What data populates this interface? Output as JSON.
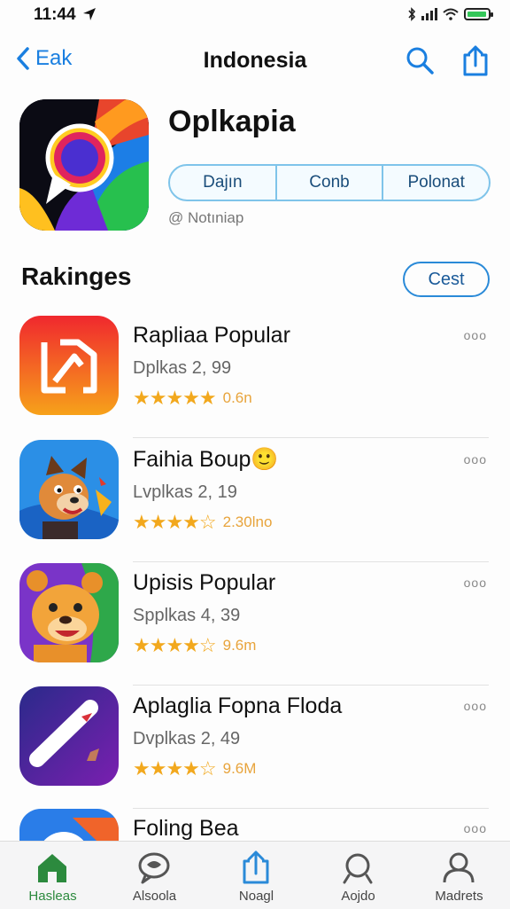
{
  "status": {
    "time": "11:44"
  },
  "nav": {
    "back_label": "Eak",
    "title": "Indonesia"
  },
  "app": {
    "title": "Oplkapia",
    "segments": [
      "Dajın",
      "Conb",
      "Polonat"
    ],
    "subtitle": "@ Notıniap"
  },
  "rankings": {
    "title": "Rakinges",
    "action_label": "Cest",
    "items": [
      {
        "name": "Rapliaa Popular",
        "subtitle": "Dplkas 2, 99",
        "stars": "★★★★★",
        "count": "0.6n",
        "more": "ooo"
      },
      {
        "name": "Faihia Boup🙂",
        "subtitle": "Lvplkas 2, 19",
        "stars": "★★★★☆",
        "count": "2.30lno",
        "more": "ooo"
      },
      {
        "name": "Upisis Popular",
        "subtitle": "Spplkas 4, 39",
        "stars": "★★★★☆",
        "count": "9.6m",
        "more": "ooo"
      },
      {
        "name": "Aplaglia Fopna Floda",
        "subtitle": "Dvplkas 2, 49",
        "stars": "★★★★☆",
        "count": "9.6M",
        "more": "ooo"
      },
      {
        "name": "Foling Bea",
        "more": "ooo"
      }
    ]
  },
  "tabs": [
    "Hasleas",
    "Alsoola",
    "Noagl",
    "Aojdo",
    "Madrets"
  ],
  "colors": {
    "accent": "#1a7fe0",
    "star": "#f2a81d",
    "active_tab": "#2c8a3e"
  }
}
